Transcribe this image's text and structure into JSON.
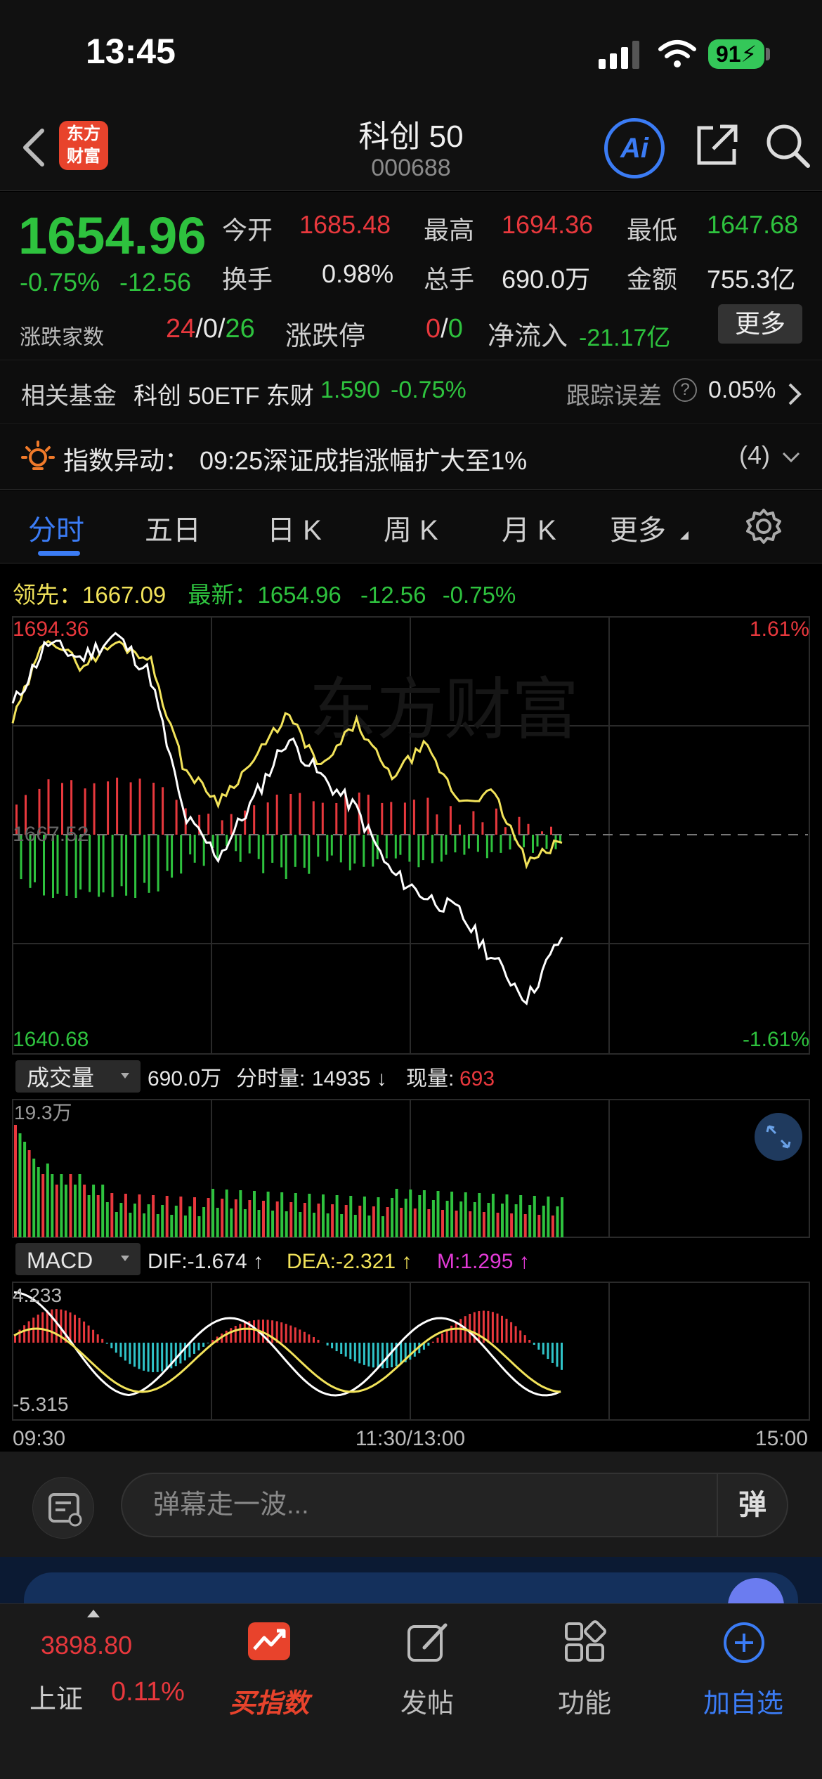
{
  "status": {
    "time": "13:45",
    "battery": "91"
  },
  "header": {
    "logo": "东方财富",
    "name": "科创 50",
    "code": "000688",
    "ai_label": "Ai"
  },
  "quote": {
    "price": "1654.96",
    "pct": "-0.75%",
    "chg": "-12.56",
    "open_label": "今开",
    "open": "1685.48",
    "high_label": "最高",
    "high": "1694.36",
    "low_label": "最低",
    "low": "1647.68",
    "turnover_label": "换手",
    "turnover": "0.98%",
    "volume_label": "总手",
    "volume": "690.0万",
    "amount_label": "金额",
    "amount": "755.3亿",
    "breadth_label": "涨跌家数",
    "up": "24",
    "flat": "0",
    "down": "26",
    "limit_label": "涨跌停",
    "limit_up": "0",
    "limit_down": "0",
    "inflow_label": "净流入",
    "inflow": "-21.17亿",
    "more": "更多",
    "sep": "/"
  },
  "fund": {
    "label": "相关基金",
    "name": "科创 50ETF 东财",
    "price": "1.590",
    "pct": "-0.75%",
    "err_label": "跟踪误差",
    "err_value": "0.05%"
  },
  "alert": {
    "label": "指数异动：",
    "text": "09:25深证成指涨幅扩大至1%",
    "count": "(4)"
  },
  "tabs": [
    "分时",
    "五日",
    "日 K",
    "周 K",
    "月 K",
    "更多"
  ],
  "chart_info": {
    "lead_label": "领先：",
    "lead_value": "1667.09",
    "latest_label": "最新：",
    "latest_value": "1654.96",
    "latest_chg": "-12.56",
    "latest_pct": "-0.75%",
    "y_top": "1694.36",
    "y_mid": "1667.52",
    "y_bottom": "1640.68",
    "pct_top": "1.61%",
    "pct_bottom": "-1.61%",
    "watermark": "东方财富",
    "vol_selector": "成交量",
    "vol_total": "690.0万",
    "vol_tick_label": "分时量:",
    "vol_tick": "14935 ↓",
    "vol_now_label": "现量:",
    "vol_now": "693",
    "vol_max": "19.3万",
    "macd_selector": "MACD",
    "dif": "DIF:-1.674 ↑",
    "dea": "DEA:-2.321 ↑",
    "m": "M:1.295 ↑",
    "macd_top": "4.233",
    "macd_bottom": "-5.315",
    "x_labels": [
      "09:30",
      "11:30/13:00",
      "15:00"
    ]
  },
  "chart_data": {
    "type": "line",
    "title": "",
    "x": [
      "09:30",
      "11:30/13:00",
      "15:00"
    ],
    "ylim": [
      1640.68,
      1694.36
    ],
    "prev_close": 1667.52,
    "series": [
      {
        "name": "最新",
        "color": "#ffffff",
        "values": [
          1684,
          1692,
          1690,
          1693,
          1688,
          1670,
          1665,
          1672,
          1680,
          1675,
          1671,
          1663,
          1660,
          1658,
          1652,
          1647,
          1655
        ]
      },
      {
        "name": "领先",
        "color": "#f2e35a",
        "values": [
          1682,
          1693,
          1689,
          1692,
          1690,
          1676,
          1672,
          1677,
          1683,
          1676,
          1682,
          1675,
          1679,
          1672,
          1673,
          1664,
          1667
        ]
      }
    ],
    "volume_max": "19.3万",
    "macd": {
      "dif": -1.674,
      "dea": -2.321,
      "m": 1.295,
      "ylim": [
        -5.315,
        4.233
      ]
    }
  },
  "danmu": {
    "placeholder": "弹幕走一波...",
    "send": "弹"
  },
  "tabbar": {
    "index_value": "3898.80",
    "index_name": "上证",
    "index_pct": "0.11%",
    "buy": "买指数",
    "post": "发帖",
    "func": "功能",
    "add": "加自选"
  },
  "colors": {
    "up": "#e8383d",
    "down": "#2ec23e",
    "accent": "#3b7cf5",
    "lead": "#f2e35a"
  }
}
